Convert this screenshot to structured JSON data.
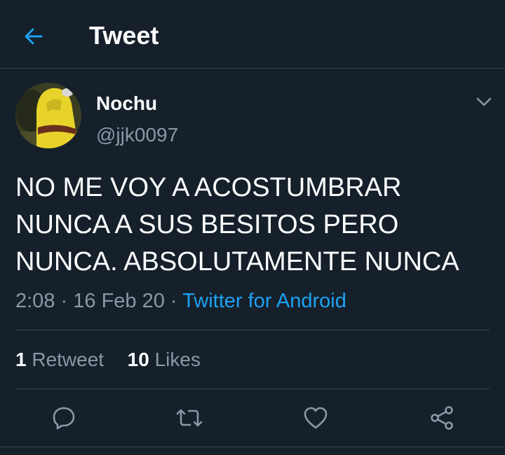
{
  "header": {
    "title": "Tweet",
    "back_icon": "arrow-left-icon"
  },
  "author": {
    "display_name": "Nochu",
    "handle": "@jjk0097",
    "avatar": "avatar-yellow-hoodie"
  },
  "tweet": {
    "text": "NO ME VOY A ACOSTUMBRAR NUNCA A SUS BESITOS PERO NUNCA. ABSOLUTAMENTE NUNCA",
    "time": "2:08",
    "date": "16 Feb 20",
    "separator": "·",
    "source": "Twitter for Android"
  },
  "stats": {
    "retweets_count": "1",
    "retweets_label": "Retweet",
    "likes_count": "10",
    "likes_label": "Likes"
  },
  "actions": {
    "icons": [
      "reply-icon",
      "retweet-icon",
      "like-icon",
      "share-icon"
    ]
  },
  "colors": {
    "background": "#15202b",
    "accent": "#1da1f2",
    "secondary_text": "#8899a6",
    "divider": "#38444d"
  }
}
